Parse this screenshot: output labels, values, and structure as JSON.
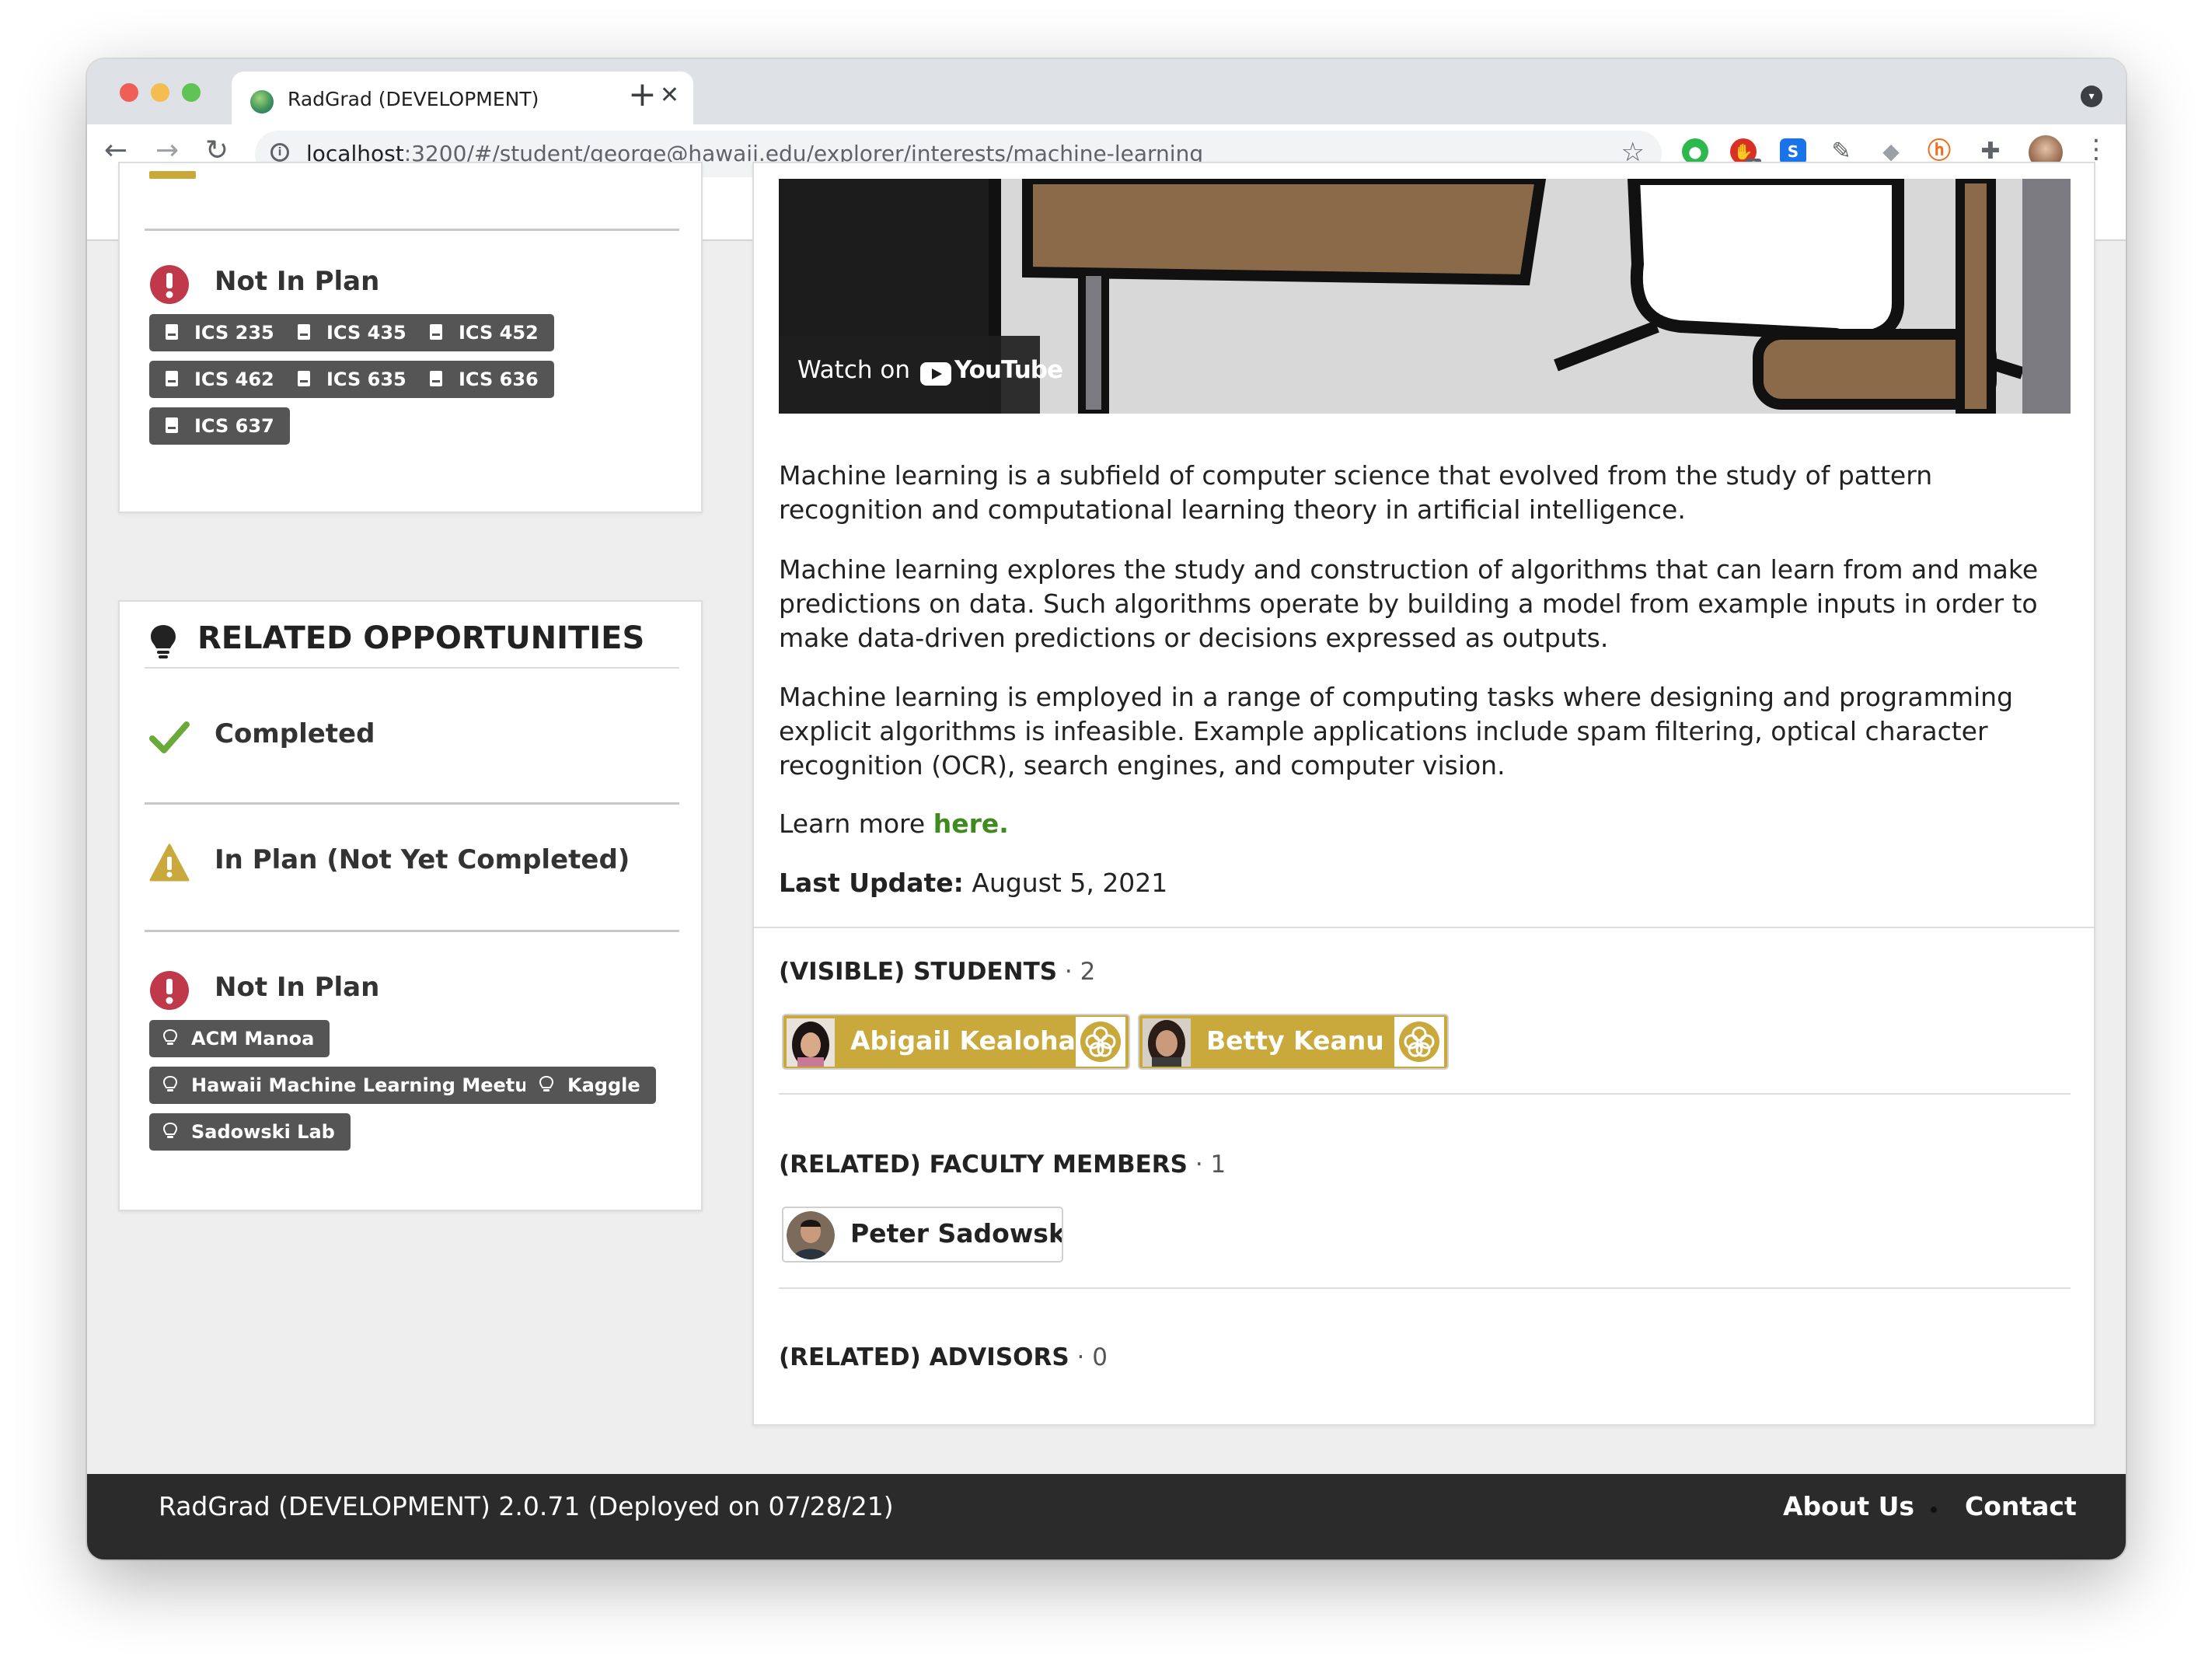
{
  "browser": {
    "tab_title": "RadGrad (DEVELOPMENT)",
    "tab_close": "✕",
    "new_tab": "+",
    "url_host": "localhost",
    "url_rest": ":3200/#/student/george@hawaii.edu/explorer/interests/machine-learning",
    "extensions": [
      "evernote-icon",
      "adblock-icon",
      "sheets-icon",
      "eyedropper-icon",
      "dropbox-icon",
      "honey-icon",
      "puzzle-icon"
    ],
    "adblock_count": "8",
    "sheets_letter": "S"
  },
  "courses_card": {
    "not_in_plan_label": "Not In Plan",
    "courses": [
      "ICS 235",
      "ICS 435",
      "ICS 452",
      "ICS 462",
      "ICS 635",
      "ICS 636",
      "ICS 637"
    ]
  },
  "opportunities_card": {
    "title": "RELATED OPPORTUNITIES",
    "completed_label": "Completed",
    "in_plan_label": "In Plan (Not Yet Completed)",
    "not_in_plan_label": "Not In Plan",
    "opportunities": [
      "ACM Manoa",
      "Hawaii Machine Learning Meetup",
      "Kaggle",
      "Sadowski Lab"
    ]
  },
  "video": {
    "watch_on": "Watch on",
    "youtube": "YouTube"
  },
  "description": {
    "p1": "Machine learning is a subfield of computer science that evolved from the study of pattern recognition and computational learning theory in artificial intelligence.",
    "p2": "Machine learning explores the study and construction of algorithms that can learn from and make predictions on data. Such algorithms operate by building a model from example inputs in order to make data-driven predictions or decisions expressed as outputs.",
    "p3": "Machine learning is employed in a range of computing tasks where designing and programming explicit algorithms is infeasible. Example applications include spam filtering, optical character recognition (OCR), search engines, and computer vision.",
    "learn_more": "Learn more ",
    "learn_more_link": "here.",
    "last_update_label": "Last Update:",
    "last_update_value": " August 5, 2021"
  },
  "students": {
    "heading": "(VISIBLE) STUDENTS",
    "count": " · 2",
    "names": [
      "Abigail Kealoha",
      "Betty Keanu"
    ]
  },
  "faculty": {
    "heading": "(RELATED) FACULTY MEMBERS",
    "count": " · 1",
    "names": [
      "Peter Sadowski"
    ]
  },
  "advisors": {
    "heading": "(RELATED) ADVISORS",
    "count": " · 0"
  },
  "footer": {
    "text": "RadGrad (DEVELOPMENT) 2.0.71 (Deployed on 07/28/21)",
    "about": "About Us",
    "contact": "Contact"
  },
  "colors": {
    "accent_green": "#3f8b1e",
    "not_in_plan_red": "#c0394b",
    "in_plan_yellow": "#c9a93b",
    "completed_green": "#6aaa3a",
    "chip_gray": "#555555",
    "footer_bg": "#2b2b2b"
  }
}
